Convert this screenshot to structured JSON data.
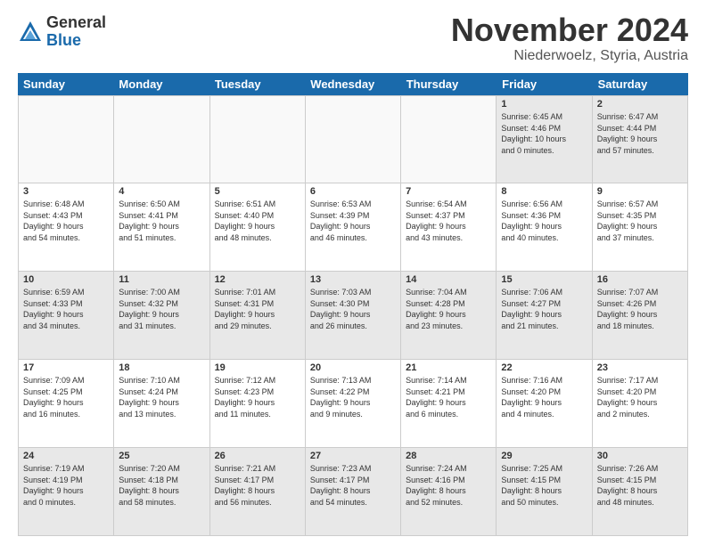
{
  "logo": {
    "general": "General",
    "blue": "Blue"
  },
  "title": "November 2024",
  "location": "Niederwoelz, Styria, Austria",
  "weekdays": [
    "Sunday",
    "Monday",
    "Tuesday",
    "Wednesday",
    "Thursday",
    "Friday",
    "Saturday"
  ],
  "weeks": [
    {
      "days": [
        {
          "num": "",
          "info": "",
          "empty": true
        },
        {
          "num": "",
          "info": "",
          "empty": true
        },
        {
          "num": "",
          "info": "",
          "empty": true
        },
        {
          "num": "",
          "info": "",
          "empty": true
        },
        {
          "num": "",
          "info": "",
          "empty": true
        },
        {
          "num": "1",
          "info": "Sunrise: 6:45 AM\nSunset: 4:46 PM\nDaylight: 10 hours\nand 0 minutes."
        },
        {
          "num": "2",
          "info": "Sunrise: 6:47 AM\nSunset: 4:44 PM\nDaylight: 9 hours\nand 57 minutes."
        }
      ]
    },
    {
      "days": [
        {
          "num": "3",
          "info": "Sunrise: 6:48 AM\nSunset: 4:43 PM\nDaylight: 9 hours\nand 54 minutes."
        },
        {
          "num": "4",
          "info": "Sunrise: 6:50 AM\nSunset: 4:41 PM\nDaylight: 9 hours\nand 51 minutes."
        },
        {
          "num": "5",
          "info": "Sunrise: 6:51 AM\nSunset: 4:40 PM\nDaylight: 9 hours\nand 48 minutes."
        },
        {
          "num": "6",
          "info": "Sunrise: 6:53 AM\nSunset: 4:39 PM\nDaylight: 9 hours\nand 46 minutes."
        },
        {
          "num": "7",
          "info": "Sunrise: 6:54 AM\nSunset: 4:37 PM\nDaylight: 9 hours\nand 43 minutes."
        },
        {
          "num": "8",
          "info": "Sunrise: 6:56 AM\nSunset: 4:36 PM\nDaylight: 9 hours\nand 40 minutes."
        },
        {
          "num": "9",
          "info": "Sunrise: 6:57 AM\nSunset: 4:35 PM\nDaylight: 9 hours\nand 37 minutes."
        }
      ]
    },
    {
      "days": [
        {
          "num": "10",
          "info": "Sunrise: 6:59 AM\nSunset: 4:33 PM\nDaylight: 9 hours\nand 34 minutes."
        },
        {
          "num": "11",
          "info": "Sunrise: 7:00 AM\nSunset: 4:32 PM\nDaylight: 9 hours\nand 31 minutes."
        },
        {
          "num": "12",
          "info": "Sunrise: 7:01 AM\nSunset: 4:31 PM\nDaylight: 9 hours\nand 29 minutes."
        },
        {
          "num": "13",
          "info": "Sunrise: 7:03 AM\nSunset: 4:30 PM\nDaylight: 9 hours\nand 26 minutes."
        },
        {
          "num": "14",
          "info": "Sunrise: 7:04 AM\nSunset: 4:28 PM\nDaylight: 9 hours\nand 23 minutes."
        },
        {
          "num": "15",
          "info": "Sunrise: 7:06 AM\nSunset: 4:27 PM\nDaylight: 9 hours\nand 21 minutes."
        },
        {
          "num": "16",
          "info": "Sunrise: 7:07 AM\nSunset: 4:26 PM\nDaylight: 9 hours\nand 18 minutes."
        }
      ]
    },
    {
      "days": [
        {
          "num": "17",
          "info": "Sunrise: 7:09 AM\nSunset: 4:25 PM\nDaylight: 9 hours\nand 16 minutes."
        },
        {
          "num": "18",
          "info": "Sunrise: 7:10 AM\nSunset: 4:24 PM\nDaylight: 9 hours\nand 13 minutes."
        },
        {
          "num": "19",
          "info": "Sunrise: 7:12 AM\nSunset: 4:23 PM\nDaylight: 9 hours\nand 11 minutes."
        },
        {
          "num": "20",
          "info": "Sunrise: 7:13 AM\nSunset: 4:22 PM\nDaylight: 9 hours\nand 9 minutes."
        },
        {
          "num": "21",
          "info": "Sunrise: 7:14 AM\nSunset: 4:21 PM\nDaylight: 9 hours\nand 6 minutes."
        },
        {
          "num": "22",
          "info": "Sunrise: 7:16 AM\nSunset: 4:20 PM\nDaylight: 9 hours\nand 4 minutes."
        },
        {
          "num": "23",
          "info": "Sunrise: 7:17 AM\nSunset: 4:20 PM\nDaylight: 9 hours\nand 2 minutes."
        }
      ]
    },
    {
      "days": [
        {
          "num": "24",
          "info": "Sunrise: 7:19 AM\nSunset: 4:19 PM\nDaylight: 9 hours\nand 0 minutes."
        },
        {
          "num": "25",
          "info": "Sunrise: 7:20 AM\nSunset: 4:18 PM\nDaylight: 8 hours\nand 58 minutes."
        },
        {
          "num": "26",
          "info": "Sunrise: 7:21 AM\nSunset: 4:17 PM\nDaylight: 8 hours\nand 56 minutes."
        },
        {
          "num": "27",
          "info": "Sunrise: 7:23 AM\nSunset: 4:17 PM\nDaylight: 8 hours\nand 54 minutes."
        },
        {
          "num": "28",
          "info": "Sunrise: 7:24 AM\nSunset: 4:16 PM\nDaylight: 8 hours\nand 52 minutes."
        },
        {
          "num": "29",
          "info": "Sunrise: 7:25 AM\nSunset: 4:15 PM\nDaylight: 8 hours\nand 50 minutes."
        },
        {
          "num": "30",
          "info": "Sunrise: 7:26 AM\nSunset: 4:15 PM\nDaylight: 8 hours\nand 48 minutes."
        }
      ]
    }
  ]
}
